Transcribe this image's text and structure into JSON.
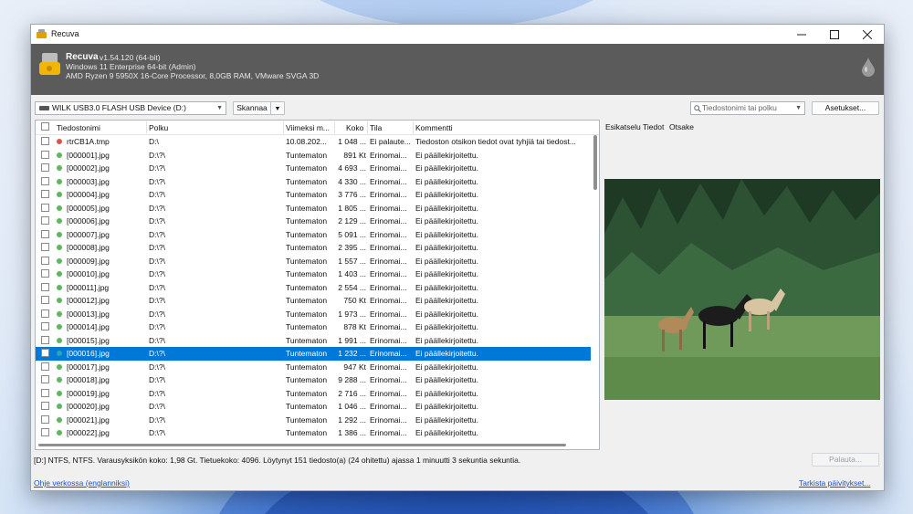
{
  "window": {
    "title": "Recuva"
  },
  "header": {
    "app_name": "Recuva",
    "version": "v1.54.120 (64-bit)",
    "os_line": "Windows 11 Enterprise 64-bit (Admin)",
    "hw_line": "AMD Ryzen 9 5950X 16-Core Processor, 8,0GB RAM, VMware SVGA 3D"
  },
  "toolbar": {
    "drive_select": "WILK USB3.0 FLASH USB Device (D:)",
    "scan_button": "Skannaa",
    "search_placeholder": "Tiedostonimi tai polku",
    "settings_button": "Asetukset..."
  },
  "table": {
    "columns": [
      "Tiedostonimi",
      "Polku",
      "Viimeksi m...",
      "Koko",
      "Tila",
      "Kommentti"
    ],
    "rows": [
      {
        "name": "rtrCB1A.tmp",
        "path": "D:\\",
        "modified": "10.08.202...",
        "size": "1 048 ...",
        "status": "Ei palaute...",
        "comment": "Tiedoston otsikon tiedot ovat tyhjiä tai tiedost...",
        "color": "#d9534f"
      },
      {
        "name": "[000001].jpg",
        "path": "D:\\?\\",
        "modified": "Tuntematon",
        "size": "891 Kt",
        "status": "Erinomai...",
        "comment": "Ei päällekirjoitettu.",
        "color": "#5cb85c"
      },
      {
        "name": "[000002].jpg",
        "path": "D:\\?\\",
        "modified": "Tuntematon",
        "size": "4 693 ...",
        "status": "Erinomai...",
        "comment": "Ei päällekirjoitettu.",
        "color": "#5cb85c"
      },
      {
        "name": "[000003].jpg",
        "path": "D:\\?\\",
        "modified": "Tuntematon",
        "size": "4 330 ...",
        "status": "Erinomai...",
        "comment": "Ei päällekirjoitettu.",
        "color": "#5cb85c"
      },
      {
        "name": "[000004].jpg",
        "path": "D:\\?\\",
        "modified": "Tuntematon",
        "size": "3 776 ...",
        "status": "Erinomai...",
        "comment": "Ei päällekirjoitettu.",
        "color": "#5cb85c"
      },
      {
        "name": "[000005].jpg",
        "path": "D:\\?\\",
        "modified": "Tuntematon",
        "size": "1 805 ...",
        "status": "Erinomai...",
        "comment": "Ei päällekirjoitettu.",
        "color": "#5cb85c"
      },
      {
        "name": "[000006].jpg",
        "path": "D:\\?\\",
        "modified": "Tuntematon",
        "size": "2 129 ...",
        "status": "Erinomai...",
        "comment": "Ei päällekirjoitettu.",
        "color": "#5cb85c"
      },
      {
        "name": "[000007].jpg",
        "path": "D:\\?\\",
        "modified": "Tuntematon",
        "size": "5 091 ...",
        "status": "Erinomai...",
        "comment": "Ei päällekirjoitettu.",
        "color": "#5cb85c"
      },
      {
        "name": "[000008].jpg",
        "path": "D:\\?\\",
        "modified": "Tuntematon",
        "size": "2 395 ...",
        "status": "Erinomai...",
        "comment": "Ei päällekirjoitettu.",
        "color": "#5cb85c"
      },
      {
        "name": "[000009].jpg",
        "path": "D:\\?\\",
        "modified": "Tuntematon",
        "size": "1 557 ...",
        "status": "Erinomai...",
        "comment": "Ei päällekirjoitettu.",
        "color": "#5cb85c"
      },
      {
        "name": "[000010].jpg",
        "path": "D:\\?\\",
        "modified": "Tuntematon",
        "size": "1 403 ...",
        "status": "Erinomai...",
        "comment": "Ei päällekirjoitettu.",
        "color": "#5cb85c"
      },
      {
        "name": "[000011].jpg",
        "path": "D:\\?\\",
        "modified": "Tuntematon",
        "size": "2 554 ...",
        "status": "Erinomai...",
        "comment": "Ei päällekirjoitettu.",
        "color": "#5cb85c"
      },
      {
        "name": "[000012].jpg",
        "path": "D:\\?\\",
        "modified": "Tuntematon",
        "size": "750 Kt",
        "status": "Erinomai...",
        "comment": "Ei päällekirjoitettu.",
        "color": "#5cb85c"
      },
      {
        "name": "[000013].jpg",
        "path": "D:\\?\\",
        "modified": "Tuntematon",
        "size": "1 973 ...",
        "status": "Erinomai...",
        "comment": "Ei päällekirjoitettu.",
        "color": "#5cb85c"
      },
      {
        "name": "[000014].jpg",
        "path": "D:\\?\\",
        "modified": "Tuntematon",
        "size": "878 Kt",
        "status": "Erinomai...",
        "comment": "Ei päällekirjoitettu.",
        "color": "#5cb85c"
      },
      {
        "name": "[000015].jpg",
        "path": "D:\\?\\",
        "modified": "Tuntematon",
        "size": "1 991 ...",
        "status": "Erinomai...",
        "comment": "Ei päällekirjoitettu.",
        "color": "#5cb85c"
      },
      {
        "name": "[000016].jpg",
        "path": "D:\\?\\",
        "modified": "Tuntematon",
        "size": "1 232 ...",
        "status": "Erinomai...",
        "comment": "Ei päällekirjoitettu.",
        "color": "#2aa7a7",
        "selected": true
      },
      {
        "name": "[000017].jpg",
        "path": "D:\\?\\",
        "modified": "Tuntematon",
        "size": "947 Kt",
        "status": "Erinomai...",
        "comment": "Ei päällekirjoitettu.",
        "color": "#5cb85c"
      },
      {
        "name": "[000018].jpg",
        "path": "D:\\?\\",
        "modified": "Tuntematon",
        "size": "9 288 ...",
        "status": "Erinomai...",
        "comment": "Ei päällekirjoitettu.",
        "color": "#5cb85c"
      },
      {
        "name": "[000019].jpg",
        "path": "D:\\?\\",
        "modified": "Tuntematon",
        "size": "2 716 ...",
        "status": "Erinomai...",
        "comment": "Ei päällekirjoitettu.",
        "color": "#5cb85c"
      },
      {
        "name": "[000020].jpg",
        "path": "D:\\?\\",
        "modified": "Tuntematon",
        "size": "1 046 ...",
        "status": "Erinomai...",
        "comment": "Ei päällekirjoitettu.",
        "color": "#5cb85c"
      },
      {
        "name": "[000021].jpg",
        "path": "D:\\?\\",
        "modified": "Tuntematon",
        "size": "1 292 ...",
        "status": "Erinomai...",
        "comment": "Ei päällekirjoitettu.",
        "color": "#5cb85c"
      },
      {
        "name": "[000022].jpg",
        "path": "D:\\?\\",
        "modified": "Tuntematon",
        "size": "1 386 ...",
        "status": "Erinomai...",
        "comment": "Ei päällekirjoitettu.",
        "color": "#5cb85c"
      }
    ]
  },
  "preview": {
    "tabs": [
      "Esikatselu",
      "Tiedot",
      "Otsake"
    ]
  },
  "status": {
    "text": "[D:] NTFS, NTFS. Varausyksikön koko: 1,98 Gt. Tietuekoko: 4096. Löytynyt 151 tiedosto(a) (24 ohitettu) ajassa 1 minuutti 3 sekuntia sekuntia.",
    "recover_button": "Palauta..."
  },
  "footer": {
    "help_link": "Ohje verkossa (englanniksi)",
    "update_link": "Tarkista päivitykset..."
  },
  "colors": {
    "selection": "#0078d7",
    "header_bg": "#5b5b5b"
  }
}
